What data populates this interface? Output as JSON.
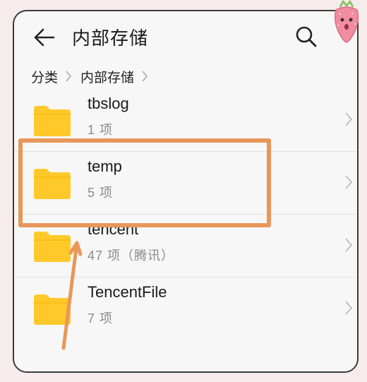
{
  "header": {
    "title": "内部存储",
    "back_icon": "arrow-left-icon",
    "search_icon": "search-icon"
  },
  "breadcrumb": {
    "items": [
      "分类",
      "内部存储"
    ]
  },
  "files": [
    {
      "name": "tbslog",
      "meta": "1 项"
    },
    {
      "name": "temp",
      "meta": "5 项"
    },
    {
      "name": "tencent",
      "meta": "47 项（腾讯）"
    },
    {
      "name": "TencentFile",
      "meta": "7 项"
    }
  ],
  "colors": {
    "folder": "#ffc929",
    "highlight": "#e8975a",
    "arrow": "#e8975a"
  }
}
